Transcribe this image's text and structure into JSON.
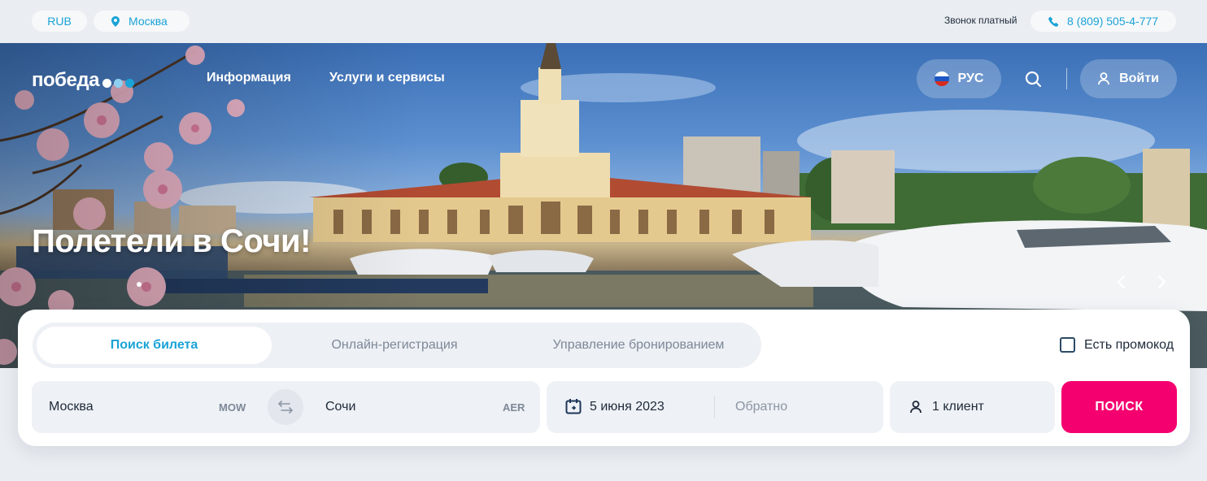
{
  "topbar": {
    "currency": "RUB",
    "city": "Москва",
    "call_note": "Звонок платный",
    "phone": "8 (809) 505-4-777"
  },
  "header": {
    "logo_text": "победа",
    "logo_dot_colors": [
      "#ffffff",
      "#8fd0f0",
      "#1aa3d6"
    ],
    "nav": [
      "Информация",
      "Услуги и сервисы"
    ],
    "language": "РУС",
    "login_label": "Войти"
  },
  "hero": {
    "headline": "Полетели в Сочи!"
  },
  "booking": {
    "tabs": [
      "Поиск билета",
      "Онлайн-регистрация",
      "Управление бронированием"
    ],
    "active_tab": "Поиск билета",
    "promo_label": "Есть промокод",
    "from_city": "Москва",
    "from_code": "MOW",
    "to_city": "Сочи",
    "to_code": "AER",
    "departure_date": "5 июня 2023",
    "return_placeholder": "Обратно",
    "passengers": "1 клиент",
    "search_label": "ПОИСК"
  },
  "colors": {
    "accent": "#1aa3d6",
    "search_button": "#f4016f",
    "page_bg": "#eaedf1"
  }
}
